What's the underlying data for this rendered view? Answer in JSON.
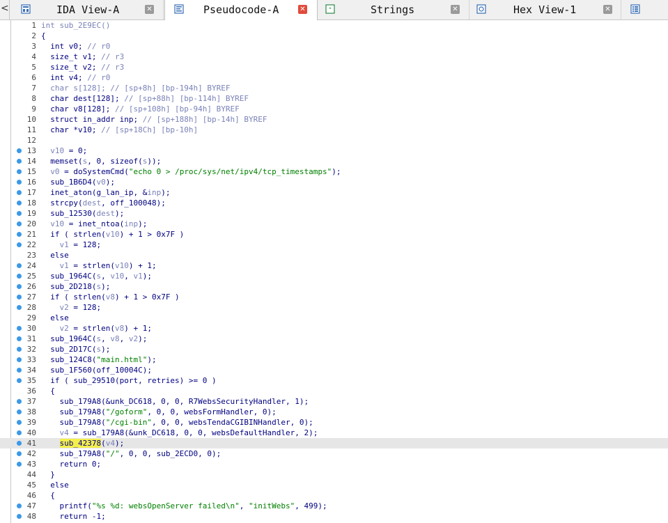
{
  "tabs": [
    {
      "label": "IDA View-A",
      "active": false,
      "icon": "graph-view-icon",
      "close_style": "grey"
    },
    {
      "label": "Pseudocode-A",
      "active": true,
      "icon": "pseudocode-icon",
      "close_style": "red"
    },
    {
      "label": "Strings",
      "active": false,
      "icon": "strings-icon",
      "close_style": "grey"
    },
    {
      "label": "Hex View-1",
      "active": false,
      "icon": "hex-view-icon",
      "close_style": "grey"
    },
    {
      "label": "",
      "active": false,
      "icon": "structures-icon",
      "close_style": "none"
    }
  ],
  "left_scroll_glyph": "<",
  "colors": {
    "breakpoint": "#3b99e8",
    "highlight_line": "#e6e6e6",
    "selection": "#f4ef4c",
    "keyword": "#000080",
    "comment": "#7a82b8",
    "string": "#008000"
  },
  "highlight_line": 41,
  "lines": [
    {
      "n": "1",
      "bp": false,
      "segs": [
        [
          "g",
          "int sub_2E9EC()"
        ]
      ]
    },
    {
      "n": "2",
      "bp": false,
      "segs": [
        [
          "k",
          "{"
        ]
      ]
    },
    {
      "n": "3",
      "bp": false,
      "segs": [
        [
          "k",
          "  int v0; "
        ],
        [
          "c",
          "// r0"
        ]
      ]
    },
    {
      "n": "4",
      "bp": false,
      "segs": [
        [
          "k",
          "  size_t v1; "
        ],
        [
          "c",
          "// r3"
        ]
      ]
    },
    {
      "n": "5",
      "bp": false,
      "segs": [
        [
          "k",
          "  size_t v2; "
        ],
        [
          "c",
          "// r3"
        ]
      ]
    },
    {
      "n": "6",
      "bp": false,
      "segs": [
        [
          "k",
          "  int v4; "
        ],
        [
          "c",
          "// r0"
        ]
      ]
    },
    {
      "n": "7",
      "bp": false,
      "segs": [
        [
          "g",
          "  char "
        ],
        [
          "g",
          "s[128]; // [sp+8h] [bp-194h] BYREF"
        ]
      ]
    },
    {
      "n": "8",
      "bp": false,
      "segs": [
        [
          "k",
          "  char dest[128]; "
        ],
        [
          "c",
          "// [sp+88h] [bp-114h] BYREF"
        ]
      ]
    },
    {
      "n": "9",
      "bp": false,
      "segs": [
        [
          "k",
          "  char v8[128]; "
        ],
        [
          "c",
          "// [sp+108h] [bp-94h] BYREF"
        ]
      ]
    },
    {
      "n": "10",
      "bp": false,
      "segs": [
        [
          "k",
          "  struct in_addr inp; "
        ],
        [
          "c",
          "// [sp+188h] [bp-14h] BYREF"
        ]
      ]
    },
    {
      "n": "11",
      "bp": false,
      "segs": [
        [
          "k",
          "  char *v10; "
        ],
        [
          "c",
          "// [sp+18Ch] [bp-10h]"
        ]
      ]
    },
    {
      "n": "12",
      "bp": false,
      "segs": []
    },
    {
      "n": "13",
      "bp": true,
      "segs": [
        [
          "c",
          "  v10"
        ],
        [
          "k",
          " = 0;"
        ]
      ]
    },
    {
      "n": "14",
      "bp": true,
      "segs": [
        [
          "k",
          "  memset("
        ],
        [
          "c",
          "s"
        ],
        [
          "k",
          ", 0, sizeof("
        ],
        [
          "c",
          "s"
        ],
        [
          "k",
          "));"
        ]
      ]
    },
    {
      "n": "15",
      "bp": true,
      "segs": [
        [
          "c",
          "  v0"
        ],
        [
          "k",
          " = doSystemCmd("
        ],
        [
          "s",
          "\"echo 0 > /proc/sys/net/ipv4/tcp_timestamps\""
        ],
        [
          "k",
          ");"
        ]
      ]
    },
    {
      "n": "16",
      "bp": true,
      "segs": [
        [
          "k",
          "  sub_1B6D4("
        ],
        [
          "c",
          "v0"
        ],
        [
          "k",
          ");"
        ]
      ]
    },
    {
      "n": "17",
      "bp": true,
      "segs": [
        [
          "k",
          "  inet_aton(g_lan_ip, &"
        ],
        [
          "c",
          "inp"
        ],
        [
          "k",
          ");"
        ]
      ]
    },
    {
      "n": "18",
      "bp": true,
      "segs": [
        [
          "k",
          "  strcpy("
        ],
        [
          "c",
          "dest"
        ],
        [
          "k",
          ", off_100048);"
        ]
      ]
    },
    {
      "n": "19",
      "bp": true,
      "segs": [
        [
          "k",
          "  sub_12530("
        ],
        [
          "c",
          "dest"
        ],
        [
          "k",
          ");"
        ]
      ]
    },
    {
      "n": "20",
      "bp": true,
      "segs": [
        [
          "c",
          "  v10"
        ],
        [
          "k",
          " = inet_ntoa("
        ],
        [
          "c",
          "inp"
        ],
        [
          "k",
          ");"
        ]
      ]
    },
    {
      "n": "21",
      "bp": true,
      "segs": [
        [
          "k",
          "  if ( strlen("
        ],
        [
          "c",
          "v10"
        ],
        [
          "k",
          ") + 1 > 0x7F )"
        ]
      ]
    },
    {
      "n": "22",
      "bp": true,
      "segs": [
        [
          "c",
          "    v1"
        ],
        [
          "k",
          " = 128;"
        ]
      ]
    },
    {
      "n": "23",
      "bp": false,
      "segs": [
        [
          "k",
          "  else"
        ]
      ]
    },
    {
      "n": "24",
      "bp": true,
      "segs": [
        [
          "c",
          "    v1"
        ],
        [
          "k",
          " = strlen("
        ],
        [
          "c",
          "v10"
        ],
        [
          "k",
          ") + 1;"
        ]
      ]
    },
    {
      "n": "25",
      "bp": true,
      "segs": [
        [
          "k",
          "  sub_1964C("
        ],
        [
          "c",
          "s"
        ],
        [
          "k",
          ", "
        ],
        [
          "c",
          "v10"
        ],
        [
          "k",
          ", "
        ],
        [
          "c",
          "v1"
        ],
        [
          "k",
          ");"
        ]
      ]
    },
    {
      "n": "26",
      "bp": true,
      "segs": [
        [
          "k",
          "  sub_2D218("
        ],
        [
          "c",
          "s"
        ],
        [
          "k",
          ");"
        ]
      ]
    },
    {
      "n": "27",
      "bp": true,
      "segs": [
        [
          "k",
          "  if ( strlen("
        ],
        [
          "c",
          "v8"
        ],
        [
          "k",
          ") + 1 > 0x7F )"
        ]
      ]
    },
    {
      "n": "28",
      "bp": true,
      "segs": [
        [
          "c",
          "    v2"
        ],
        [
          "k",
          " = 128;"
        ]
      ]
    },
    {
      "n": "29",
      "bp": false,
      "segs": [
        [
          "k",
          "  else"
        ]
      ]
    },
    {
      "n": "30",
      "bp": true,
      "segs": [
        [
          "c",
          "    v2"
        ],
        [
          "k",
          " = strlen("
        ],
        [
          "c",
          "v8"
        ],
        [
          "k",
          ") + 1;"
        ]
      ]
    },
    {
      "n": "31",
      "bp": true,
      "segs": [
        [
          "k",
          "  sub_1964C("
        ],
        [
          "c",
          "s"
        ],
        [
          "k",
          ", "
        ],
        [
          "c",
          "v8"
        ],
        [
          "k",
          ", "
        ],
        [
          "c",
          "v2"
        ],
        [
          "k",
          ");"
        ]
      ]
    },
    {
      "n": "32",
      "bp": true,
      "segs": [
        [
          "k",
          "  sub_2D17C("
        ],
        [
          "c",
          "s"
        ],
        [
          "k",
          ");"
        ]
      ]
    },
    {
      "n": "33",
      "bp": true,
      "segs": [
        [
          "k",
          "  sub_124C8("
        ],
        [
          "s",
          "\"main.html\""
        ],
        [
          "k",
          ");"
        ]
      ]
    },
    {
      "n": "34",
      "bp": true,
      "segs": [
        [
          "k",
          "  sub_1F560(off_10004C);"
        ]
      ]
    },
    {
      "n": "35",
      "bp": true,
      "segs": [
        [
          "k",
          "  if ( sub_29510(port, retries) >= 0 )"
        ]
      ]
    },
    {
      "n": "36",
      "bp": false,
      "segs": [
        [
          "k",
          "  {"
        ]
      ]
    },
    {
      "n": "37",
      "bp": true,
      "segs": [
        [
          "k",
          "    sub_179A8(&unk_DC618, 0, 0, R7WebsSecurityHandler, 1);"
        ]
      ]
    },
    {
      "n": "38",
      "bp": true,
      "segs": [
        [
          "k",
          "    sub_179A8("
        ],
        [
          "s",
          "\"/goform\""
        ],
        [
          "k",
          ", 0, 0, websFormHandler, 0);"
        ]
      ]
    },
    {
      "n": "39",
      "bp": true,
      "segs": [
        [
          "k",
          "    sub_179A8("
        ],
        [
          "s",
          "\"/cgi-bin\""
        ],
        [
          "k",
          ", 0, 0, websTendaCGIBINHandler, 0);"
        ]
      ]
    },
    {
      "n": "40",
      "bp": true,
      "segs": [
        [
          "c",
          "    v4"
        ],
        [
          "k",
          " = sub_179A8(&unk_DC618, 0, 0, websDefaultHandler, 2);"
        ]
      ]
    },
    {
      "n": "41",
      "bp": true,
      "segs": [
        [
          "k",
          "    "
        ],
        [
          "sel",
          "sub_42378"
        ],
        [
          "k",
          "("
        ],
        [
          "c",
          "v4"
        ],
        [
          "k",
          ");"
        ]
      ]
    },
    {
      "n": "42",
      "bp": true,
      "segs": [
        [
          "k",
          "    sub_179A8("
        ],
        [
          "s",
          "\"/\""
        ],
        [
          "k",
          ", 0, 0, sub_2ECD0, 0);"
        ]
      ]
    },
    {
      "n": "43",
      "bp": true,
      "segs": [
        [
          "k",
          "    return 0;"
        ]
      ]
    },
    {
      "n": "44",
      "bp": false,
      "segs": [
        [
          "k",
          "  }"
        ]
      ]
    },
    {
      "n": "45",
      "bp": false,
      "segs": [
        [
          "k",
          "  else"
        ]
      ]
    },
    {
      "n": "46",
      "bp": false,
      "segs": [
        [
          "k",
          "  {"
        ]
      ]
    },
    {
      "n": "47",
      "bp": true,
      "segs": [
        [
          "k",
          "    printf("
        ],
        [
          "s",
          "\"%s %d: websOpenServer failed\\n\""
        ],
        [
          "k",
          ", "
        ],
        [
          "s",
          "\"initWebs\""
        ],
        [
          "k",
          ", 499);"
        ]
      ]
    },
    {
      "n": "48",
      "bp": true,
      "segs": [
        [
          "k",
          "    return -1;"
        ]
      ]
    }
  ]
}
